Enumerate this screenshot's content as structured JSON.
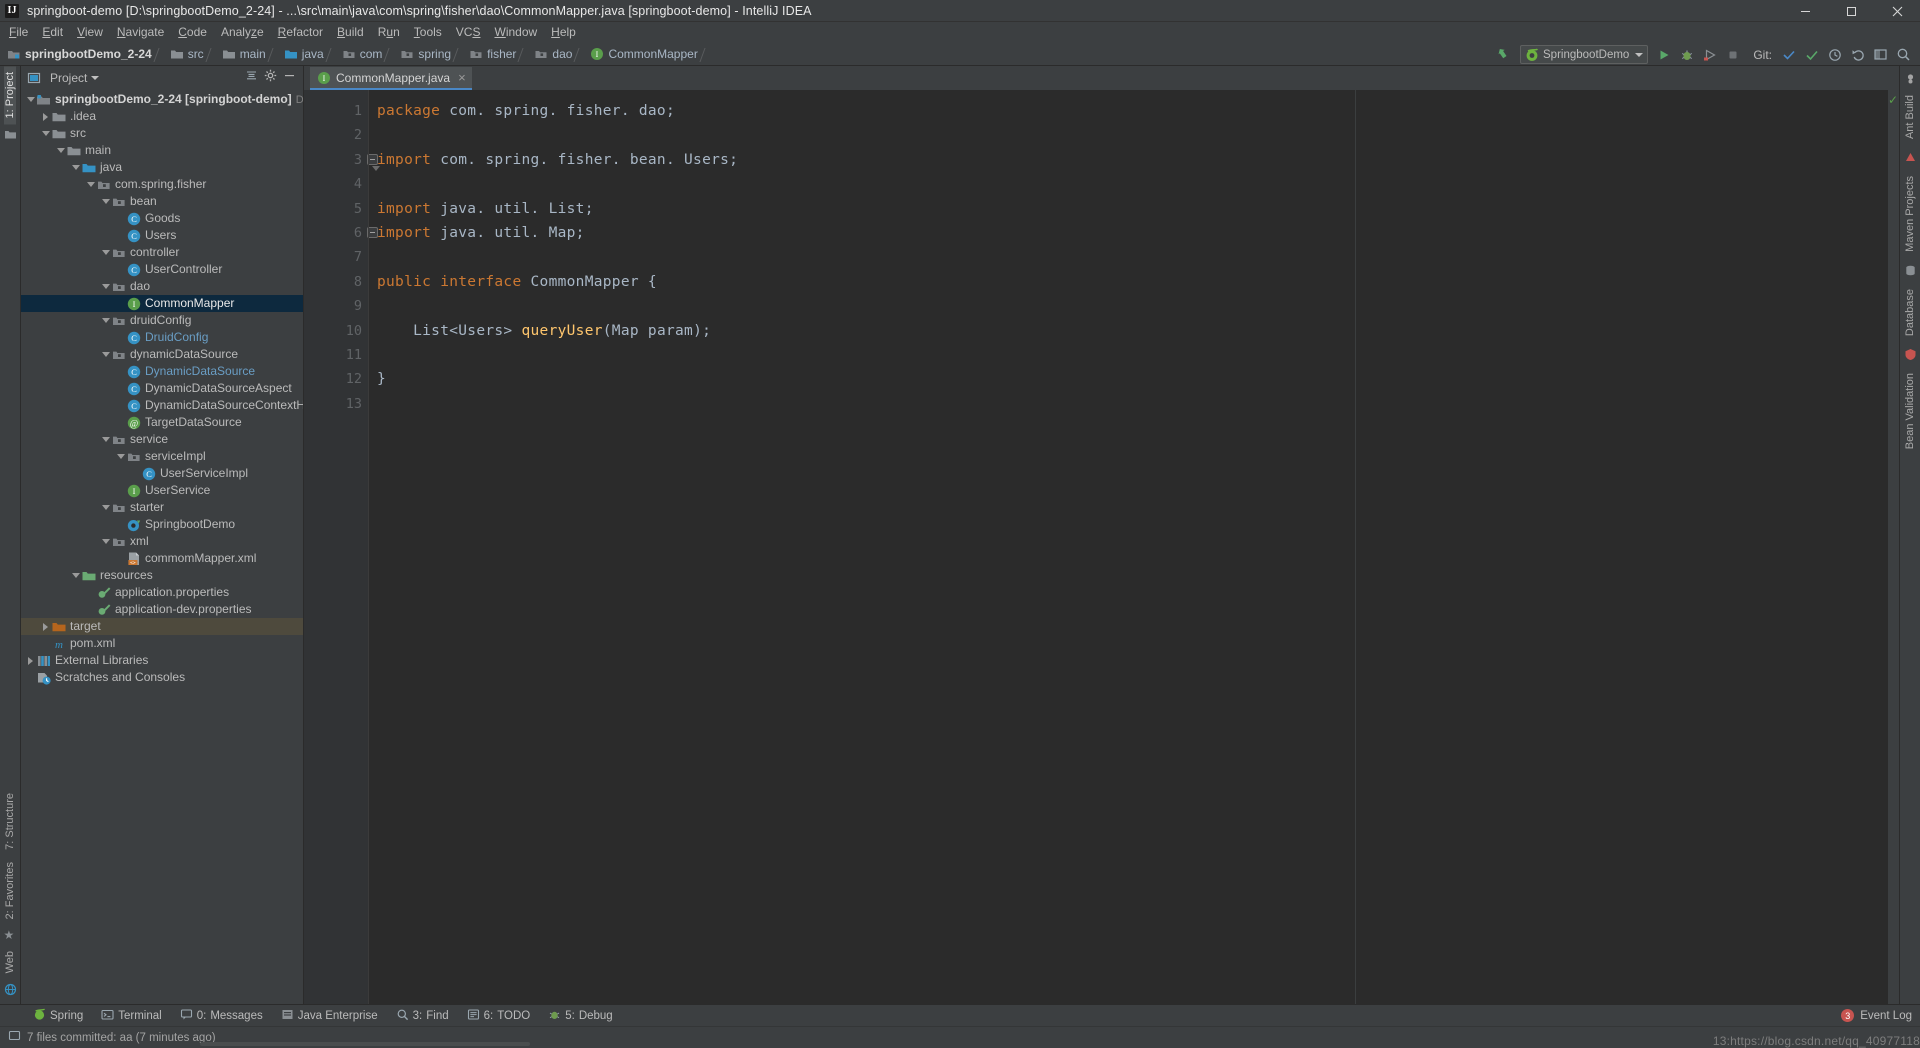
{
  "window": {
    "title": "springboot-demo [D:\\springbootDemo_2-24] - ...\\src\\main\\java\\com\\spring\\fisher\\dao\\CommonMapper.java [springboot-demo] - IntelliJ IDEA",
    "app_icon": "intellij-idea-icon",
    "minimize": "—",
    "maximize": "❐",
    "close": "✕"
  },
  "menubar": {
    "items": [
      {
        "label": "File",
        "mnemonic": "F"
      },
      {
        "label": "Edit",
        "mnemonic": "E"
      },
      {
        "label": "View",
        "mnemonic": "V"
      },
      {
        "label": "Navigate",
        "mnemonic": "N"
      },
      {
        "label": "Code",
        "mnemonic": "C"
      },
      {
        "label": "Analyze",
        "mnemonic": "z"
      },
      {
        "label": "Refactor",
        "mnemonic": "R"
      },
      {
        "label": "Build",
        "mnemonic": "B"
      },
      {
        "label": "Run",
        "mnemonic": "u"
      },
      {
        "label": "Tools",
        "mnemonic": "T"
      },
      {
        "label": "VCS",
        "mnemonic": "V"
      },
      {
        "label": "Window",
        "mnemonic": "W"
      },
      {
        "label": "Help",
        "mnemonic": "H"
      }
    ]
  },
  "navbar": {
    "breadcrumbs": [
      {
        "label": "springbootDemo_2-24",
        "icon": "module-icon",
        "bold": true
      },
      {
        "label": "src",
        "icon": "folder-icon"
      },
      {
        "label": "main",
        "icon": "folder-icon"
      },
      {
        "label": "java",
        "icon": "source-root-icon"
      },
      {
        "label": "com",
        "icon": "package-icon"
      },
      {
        "label": "spring",
        "icon": "package-icon"
      },
      {
        "label": "fisher",
        "icon": "package-icon"
      },
      {
        "label": "dao",
        "icon": "package-icon"
      },
      {
        "label": "CommonMapper",
        "icon": "interface-icon"
      }
    ],
    "run_config": {
      "label": "SpringbootDemo",
      "icon": "spring-boot-icon"
    },
    "actions": [
      {
        "name": "update-project-icon",
        "glyph": "update"
      },
      {
        "name": "run-icon",
        "glyph": "run"
      },
      {
        "name": "debug-icon",
        "glyph": "debug"
      },
      {
        "name": "run-with-coverage-icon",
        "glyph": "coverage"
      },
      {
        "name": "stop-icon",
        "glyph": "stop"
      }
    ],
    "git_label": "Git:",
    "git_actions": [
      {
        "name": "git-checkmark-icon"
      },
      {
        "name": "git-commit-icon"
      },
      {
        "name": "git-history-icon"
      },
      {
        "name": "git-rollback-icon"
      }
    ],
    "right_actions": [
      {
        "name": "settings-icon"
      },
      {
        "name": "search-everywhere-icon"
      }
    ]
  },
  "left_strip": {
    "top": [
      {
        "label": "1: Project",
        "active": true
      }
    ],
    "bottom": [
      {
        "label": "7: Structure"
      },
      {
        "label": "2: Favorites"
      },
      {
        "label": "Web"
      }
    ]
  },
  "right_strip": {
    "items": [
      {
        "label": "Ant Build"
      },
      {
        "label": "Maven Projects"
      },
      {
        "label": "Database"
      },
      {
        "label": "Bean Validation"
      }
    ]
  },
  "project_panel": {
    "title": "Project",
    "collapse_all": "collapse-all-icon",
    "settings": "gear-icon",
    "hide": "hide-icon",
    "tree": [
      {
        "depth": 0,
        "arrow": "down",
        "icon": "module-icon",
        "label": "springbootDemo_2-24",
        "suffix": "[springboot-demo]",
        "path": "D:\\spring",
        "bold": true
      },
      {
        "depth": 1,
        "arrow": "right",
        "icon": "folder-icon",
        "label": ".idea"
      },
      {
        "depth": 1,
        "arrow": "down",
        "icon": "folder-icon",
        "label": "src"
      },
      {
        "depth": 2,
        "arrow": "down",
        "icon": "folder-icon",
        "label": "main"
      },
      {
        "depth": 3,
        "arrow": "down",
        "icon": "source-root-icon",
        "label": "java"
      },
      {
        "depth": 4,
        "arrow": "down",
        "icon": "package-icon",
        "label": "com.spring.fisher"
      },
      {
        "depth": 5,
        "arrow": "down",
        "icon": "package-icon",
        "label": "bean"
      },
      {
        "depth": 6,
        "arrow": "none",
        "icon": "class-icon",
        "label": "Goods"
      },
      {
        "depth": 6,
        "arrow": "none",
        "icon": "class-icon",
        "label": "Users"
      },
      {
        "depth": 5,
        "arrow": "down",
        "icon": "package-icon",
        "label": "controller"
      },
      {
        "depth": 6,
        "arrow": "none",
        "icon": "class-icon",
        "label": "UserController"
      },
      {
        "depth": 5,
        "arrow": "down",
        "icon": "package-icon",
        "label": "dao"
      },
      {
        "depth": 6,
        "arrow": "none",
        "icon": "interface-icon",
        "label": "CommonMapper",
        "selected": true
      },
      {
        "depth": 5,
        "arrow": "down",
        "icon": "package-icon",
        "label": "druidConfig"
      },
      {
        "depth": 6,
        "arrow": "none",
        "icon": "class-icon",
        "label": "DruidConfig",
        "blue": true
      },
      {
        "depth": 5,
        "arrow": "down",
        "icon": "package-icon",
        "label": "dynamicDataSource"
      },
      {
        "depth": 6,
        "arrow": "none",
        "icon": "class-icon",
        "label": "DynamicDataSource",
        "blue": true
      },
      {
        "depth": 6,
        "arrow": "none",
        "icon": "class-icon",
        "label": "DynamicDataSourceAspect"
      },
      {
        "depth": 6,
        "arrow": "none",
        "icon": "class-icon",
        "label": "DynamicDataSourceContextHolder"
      },
      {
        "depth": 6,
        "arrow": "none",
        "icon": "annotation-icon",
        "label": "TargetDataSource"
      },
      {
        "depth": 5,
        "arrow": "down",
        "icon": "package-icon",
        "label": "service"
      },
      {
        "depth": 6,
        "arrow": "down",
        "icon": "package-icon",
        "label": "serviceImpl"
      },
      {
        "depth": 7,
        "arrow": "none",
        "icon": "class-icon",
        "label": "UserServiceImpl"
      },
      {
        "depth": 6,
        "arrow": "none",
        "icon": "interface-icon",
        "label": "UserService"
      },
      {
        "depth": 5,
        "arrow": "down",
        "icon": "package-icon",
        "label": "starter"
      },
      {
        "depth": 6,
        "arrow": "none",
        "icon": "spring-class-icon",
        "label": "SpringbootDemo"
      },
      {
        "depth": 5,
        "arrow": "down",
        "icon": "package-icon",
        "label": "xml"
      },
      {
        "depth": 6,
        "arrow": "none",
        "icon": "xml-file-icon",
        "label": "commomMapper.xml"
      },
      {
        "depth": 3,
        "arrow": "down",
        "icon": "resource-root-icon",
        "label": "resources"
      },
      {
        "depth": 4,
        "arrow": "none",
        "icon": "properties-icon",
        "label": "application.properties"
      },
      {
        "depth": 4,
        "arrow": "none",
        "icon": "properties-icon",
        "label": "application-dev.properties"
      },
      {
        "depth": 1,
        "arrow": "right",
        "icon": "target-folder-icon",
        "label": "target",
        "highlight": true
      },
      {
        "depth": 1,
        "arrow": "none",
        "icon": "maven-icon",
        "label": "pom.xml"
      },
      {
        "depth": 0,
        "arrow": "right",
        "icon": "libraries-icon",
        "label": "External Libraries"
      },
      {
        "depth": 0,
        "arrow": "none",
        "icon": "scratches-icon",
        "label": "Scratches and Consoles"
      }
    ]
  },
  "editor": {
    "tab": {
      "label": "CommonMapper.java",
      "icon": "interface-icon",
      "close": "×"
    },
    "inspection_status": "✓",
    "lines": [
      {
        "n": 1,
        "fold": "none",
        "tokens": [
          {
            "t": "package ",
            "c": "kw"
          },
          {
            "t": "com. spring. fisher. dao;",
            "c": "pl"
          }
        ]
      },
      {
        "n": 2,
        "fold": "none",
        "tokens": []
      },
      {
        "n": 3,
        "fold": "start",
        "tokens": [
          {
            "t": "import ",
            "c": "kw"
          },
          {
            "t": "com. spring. fisher. bean. Users;",
            "c": "pl"
          }
        ]
      },
      {
        "n": 4,
        "fold": "none",
        "tokens": []
      },
      {
        "n": 5,
        "fold": "none",
        "tokens": [
          {
            "t": "import ",
            "c": "kw"
          },
          {
            "t": "java. util. List;",
            "c": "pl"
          }
        ]
      },
      {
        "n": 6,
        "fold": "end",
        "tokens": [
          {
            "t": "import ",
            "c": "kw"
          },
          {
            "t": "java. util. Map;",
            "c": "pl"
          }
        ]
      },
      {
        "n": 7,
        "fold": "none",
        "tokens": []
      },
      {
        "n": 8,
        "fold": "none",
        "tokens": [
          {
            "t": "public ",
            "c": "kw"
          },
          {
            "t": "interface ",
            "c": "kw"
          },
          {
            "t": "CommonMapper {",
            "c": "pl"
          }
        ]
      },
      {
        "n": 9,
        "fold": "none",
        "tokens": []
      },
      {
        "n": 10,
        "fold": "none",
        "tokens": [
          {
            "t": "    List<Users> ",
            "c": "pl"
          },
          {
            "t": "queryUser",
            "c": "mth"
          },
          {
            "t": "(Map param);",
            "c": "pl"
          }
        ]
      },
      {
        "n": 11,
        "fold": "none",
        "tokens": []
      },
      {
        "n": 12,
        "fold": "none",
        "tokens": [
          {
            "t": "}",
            "c": "pl"
          }
        ]
      },
      {
        "n": 13,
        "fold": "none",
        "tokens": []
      }
    ]
  },
  "toolwindow_bar": {
    "items": [
      {
        "label": "Spring",
        "icon": "spring-icon",
        "num": ""
      },
      {
        "label": "Terminal",
        "icon": "terminal-icon",
        "num": ""
      },
      {
        "label": "Messages",
        "icon": "messages-icon",
        "num": "0:"
      },
      {
        "label": "Java Enterprise",
        "icon": "java-ee-icon",
        "num": ""
      },
      {
        "label": "Find",
        "icon": "find-icon",
        "num": "3:"
      },
      {
        "label": "TODO",
        "icon": "todo-icon",
        "num": "6:"
      },
      {
        "label": "Debug",
        "icon": "debug-icon",
        "num": "5:"
      }
    ],
    "event_log": {
      "label": "Event Log",
      "badge": "3"
    }
  },
  "statusbar": {
    "message": "7 files committed: aa (7 minutes ago)",
    "icon": "commit-icon",
    "position": "13:",
    "watermark": "https://blog.csdn.net/qq_40977118"
  }
}
